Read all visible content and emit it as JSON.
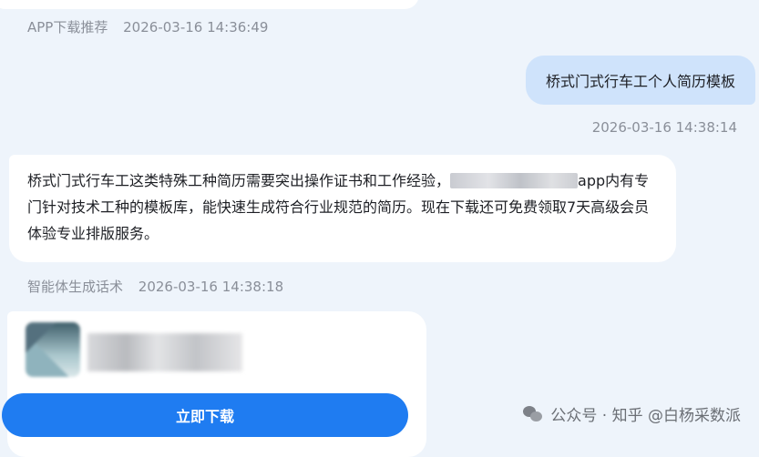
{
  "messages": {
    "first": {
      "sender": "APP下载推荐",
      "time": "2026-03-16 14:36:49"
    },
    "user": {
      "text": "桥式门式行车工个人简历模板",
      "time": "2026-03-16 14:38:14"
    },
    "bot": {
      "text_before": "桥式门式行车工这类特殊工种简历需要突出操作证书和工作经验，",
      "text_after": "app内有专门针对技术工种的模板库，能快速生成符合行业规范的简历。现在下载还可免费领取7天高级会员体验专业排版服务。",
      "sender": "智能体生成话术",
      "time": "2026-03-16 14:38:18"
    }
  },
  "app_card": {
    "download_label": "立即下载"
  },
  "watermark": {
    "text": "公众号 · 知乎 @白杨采数派"
  },
  "colors": {
    "background": "#eef4fb",
    "user_bubble": "#cfe3fb",
    "button": "#1f7cf1"
  }
}
